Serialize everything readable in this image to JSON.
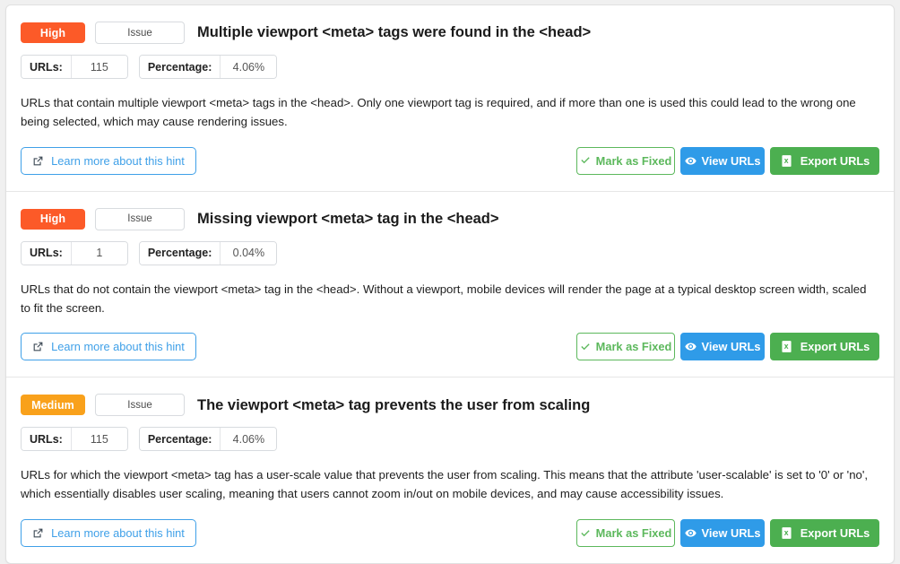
{
  "colors": {
    "severity_high": "#fc5a28",
    "severity_medium": "#f9a11b",
    "link_blue": "#3fa0e8",
    "view_blue": "#2f9be8",
    "export_green": "#4caf50",
    "fixed_green": "#5cb85c",
    "page_background": "#f0f0f0",
    "card_background": "#ffffff"
  },
  "labels": {
    "urls_label": "URLs:",
    "percentage_label": "Percentage:",
    "learn_more": "Learn more about this hint",
    "mark_as_fixed": "Mark as Fixed",
    "view_urls": "View URLs",
    "export_urls": "Export URLs"
  },
  "icons": {
    "external_link": "external-link-icon",
    "check": "check-icon",
    "eye": "eye-icon",
    "file_export": "file-export-icon"
  },
  "hints": [
    {
      "severity": "High",
      "type": "Issue",
      "title": "Multiple viewport <meta> tags were found in the <head>",
      "urls": "115",
      "percentage": "4.06%",
      "description": "URLs that contain multiple viewport <meta> tags in the <head>. Only one viewport tag is required, and if more than one is used this could lead to the wrong one being selected, which may cause rendering issues."
    },
    {
      "severity": "High",
      "type": "Issue",
      "title": "Missing viewport <meta> tag in the <head>",
      "urls": "1",
      "percentage": "0.04%",
      "description": "URLs that do not contain the viewport <meta> tag in the <head>. Without a viewport, mobile devices will render the page at a typical desktop screen width, scaled to fit the screen."
    },
    {
      "severity": "Medium",
      "type": "Issue",
      "title": "The viewport <meta> tag prevents the user from scaling",
      "urls": "115",
      "percentage": "4.06%",
      "description": "URLs for which the viewport <meta> tag has a user-scale value that prevents the user from scaling. This means that the attribute 'user-scalable' is set to '0' or 'no', which essentially disables user scaling, meaning that users cannot zoom in/out on mobile devices, and may cause accessibility issues."
    }
  ]
}
